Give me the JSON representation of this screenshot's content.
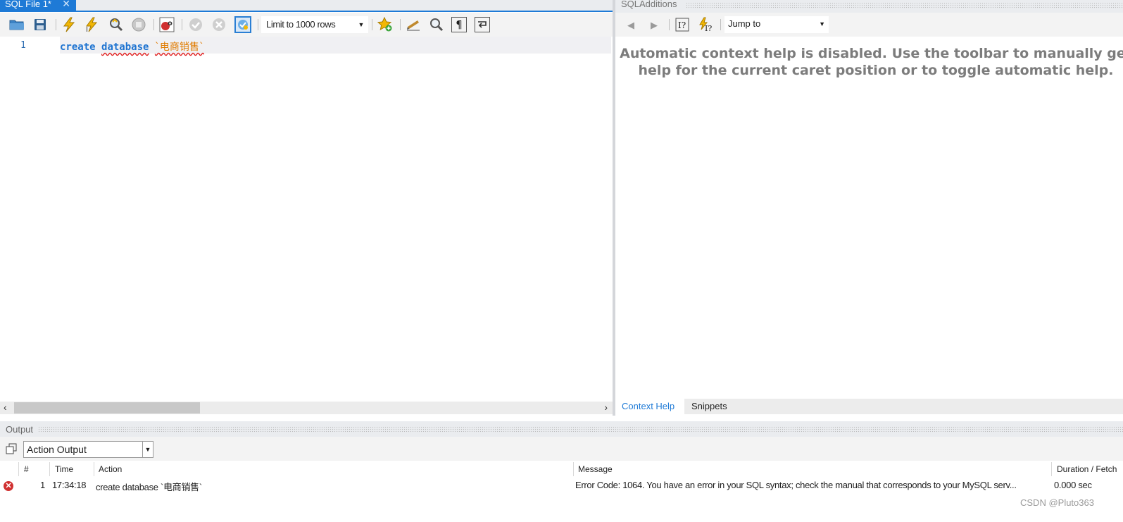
{
  "editor": {
    "tab_label": "SQL File 1*",
    "tab_close": "✕",
    "limit_rows": "Limit to 1000 rows",
    "line_number": "1",
    "code": {
      "kw1": "create",
      "kw2": "database",
      "str": "`电商销售`"
    },
    "scroll_left": "‹",
    "scroll_right": "›"
  },
  "sql_additions": {
    "title": "SQLAdditions",
    "jump_to": "Jump to",
    "help_line1": "Automatic context help is disabled. Use the toolbar to manually get",
    "help_line2": "help for the current caret position or to toggle automatic help.",
    "tabs": {
      "context_help": "Context Help",
      "snippets": "Snippets"
    }
  },
  "output": {
    "title": "Output",
    "selector": "Action Output",
    "columns": {
      "num": "#",
      "time": "Time",
      "action": "Action",
      "message": "Message",
      "duration": "Duration / Fetch"
    },
    "rows": [
      {
        "num": "1",
        "time": "17:34:18",
        "action": "create database `电商销售`",
        "message": "Error Code: 1064. You have an error in your SQL syntax; check the manual that corresponds to your MySQL serv...",
        "duration": "0.000 sec"
      }
    ]
  },
  "watermark": "CSDN @Pluto363",
  "icons": {
    "left_toolbar": [
      "open-folder-icon",
      "save-icon",
      "execute-icon",
      "execute-current-icon",
      "explain-icon",
      "stop-icon",
      "toggle-error-icon",
      "commit-icon",
      "rollback-icon",
      "autocommit-icon",
      "add-snippet-icon",
      "beautify-icon",
      "find-icon",
      "invisible-chars-icon",
      "wrap-icon"
    ],
    "right_toolbar": [
      "back-icon",
      "forward-icon",
      "manual-help-icon",
      "auto-help-icon"
    ]
  },
  "colors": {
    "accent": "#1e7ad6",
    "keyword": "#1f74d1",
    "string": "#e07b00",
    "error": "#d03030"
  }
}
